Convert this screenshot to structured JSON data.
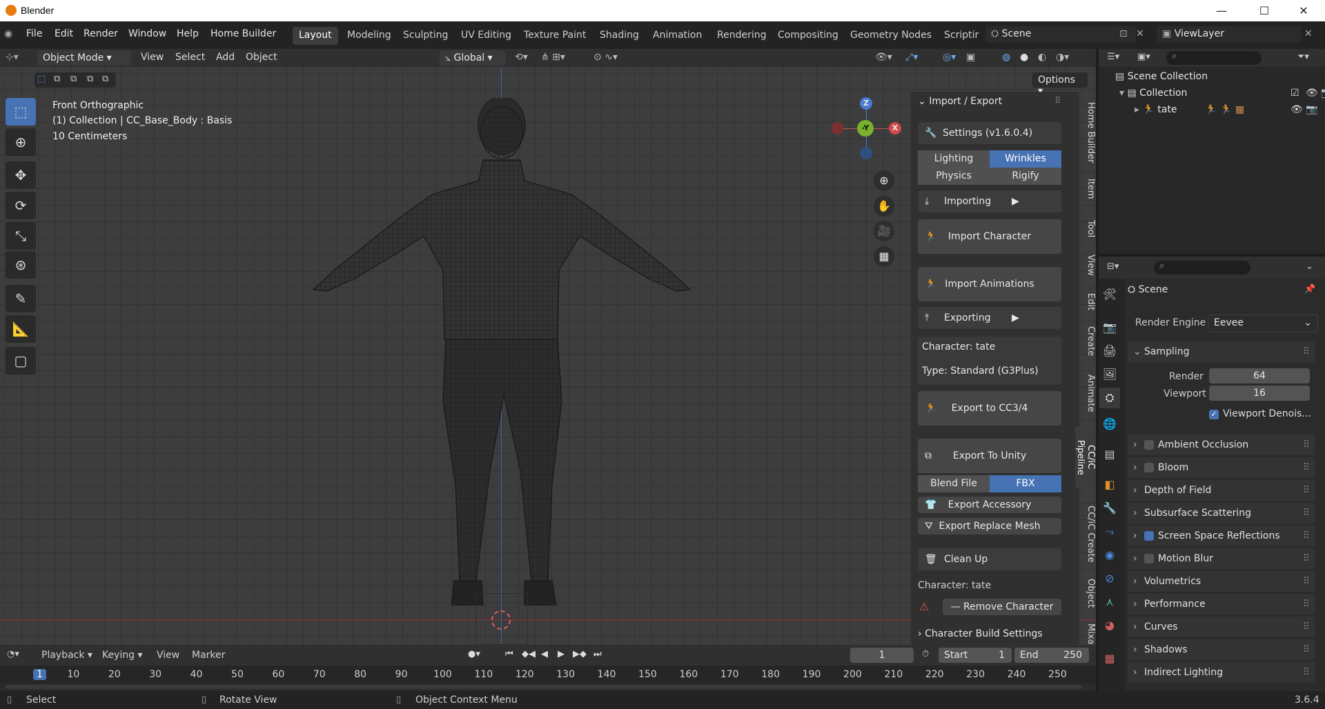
{
  "window": {
    "title": "Blender",
    "minimize": "—",
    "maximize": "☐",
    "close": "✕"
  },
  "menu": [
    "File",
    "Edit",
    "Render",
    "Window",
    "Help",
    "Home Builder"
  ],
  "workspaces": [
    "Layout",
    "Modeling",
    "Sculpting",
    "UV Editing",
    "Texture Paint",
    "Shading",
    "Animation",
    "Rendering",
    "Compositing",
    "Geometry Nodes",
    "Scriptir"
  ],
  "scene": {
    "name": "Scene",
    "viewlayer": "ViewLayer"
  },
  "viewport_header": {
    "mode": "Object Mode",
    "view": "View",
    "select": "Select",
    "add": "Add",
    "object": "Object",
    "orientation": "Global",
    "options": "Options"
  },
  "viewport_overlay": {
    "view_name": "Front Orthographic",
    "collection_info": "(1) Collection | CC_Base_Body : Basis",
    "scale": "10 Centimeters"
  },
  "gizmo": {
    "z": "Z",
    "y": "-Y",
    "x": "X"
  },
  "npanel": {
    "header": "Import / Export",
    "settings": "Settings  (v1.6.0.4)",
    "seg1": [
      "Lighting",
      "Wrinkles"
    ],
    "seg2": [
      "Physics",
      "Rigify"
    ],
    "importing": "Importing",
    "import_character": "Import Character",
    "import_animations": "Import Animations",
    "exporting": "Exporting",
    "character": "Character: tate",
    "type": "Type: Standard (G3Plus)",
    "export_cc": "Export to CC3/4",
    "export_unity": "Export To Unity",
    "seg3": [
      "Blend File",
      "FBX"
    ],
    "export_accessory": "Export Accessory",
    "export_replace": "Export Replace Mesh",
    "clean_up": "Clean Up",
    "character2": "Character: tate",
    "remove": "Remove Character",
    "build": "Character Build Settings"
  },
  "side_tabs": [
    "Home Builder",
    "Item",
    "Tool",
    "View",
    "Edit",
    "Create",
    "Animate",
    "CC/iC Pipeline",
    "CC/iC Create",
    "Object",
    "Mixa"
  ],
  "outliner": {
    "scene_collection": "Scene Collection",
    "collection": "Collection",
    "object": "tate"
  },
  "properties": {
    "scene": "Scene",
    "render_engine_label": "Render Engine",
    "render_engine": "Eevee",
    "sampling": "Sampling",
    "render_label": "Render",
    "render_val": "64",
    "viewport_label": "Viewport",
    "viewport_val": "16",
    "denoise": "Viewport Denois...",
    "sections": [
      {
        "label": "Ambient Occlusion",
        "checkbox": true,
        "checked": false
      },
      {
        "label": "Bloom",
        "checkbox": true,
        "checked": false
      },
      {
        "label": "Depth of Field",
        "checkbox": false,
        "checked": false
      },
      {
        "label": "Subsurface Scattering",
        "checkbox": false,
        "checked": false
      },
      {
        "label": "Screen Space Reflections",
        "checkbox": true,
        "checked": true
      },
      {
        "label": "Motion Blur",
        "checkbox": true,
        "checked": false
      },
      {
        "label": "Volumetrics",
        "checkbox": false,
        "checked": false
      },
      {
        "label": "Performance",
        "checkbox": false,
        "checked": false
      },
      {
        "label": "Curves",
        "checkbox": false,
        "checked": false
      },
      {
        "label": "Shadows",
        "checkbox": false,
        "checked": false
      },
      {
        "label": "Indirect Lighting",
        "checkbox": false,
        "checked": false
      }
    ]
  },
  "timeline": {
    "playback": "Playback",
    "keying": "Keying",
    "view": "View",
    "marker": "Marker",
    "current_frame": "1",
    "start_label": "Start",
    "start": "1",
    "end_label": "End",
    "end": "250",
    "ticks": [
      "1",
      "10",
      "20",
      "30",
      "40",
      "50",
      "60",
      "70",
      "80",
      "90",
      "100",
      "110",
      "120",
      "130",
      "140",
      "150",
      "160",
      "170",
      "180",
      "190",
      "200",
      "210",
      "220",
      "230",
      "240",
      "250"
    ]
  },
  "status": {
    "select": "Select",
    "rotate": "Rotate View",
    "context": "Object Context Menu",
    "version": "3.6.4"
  }
}
